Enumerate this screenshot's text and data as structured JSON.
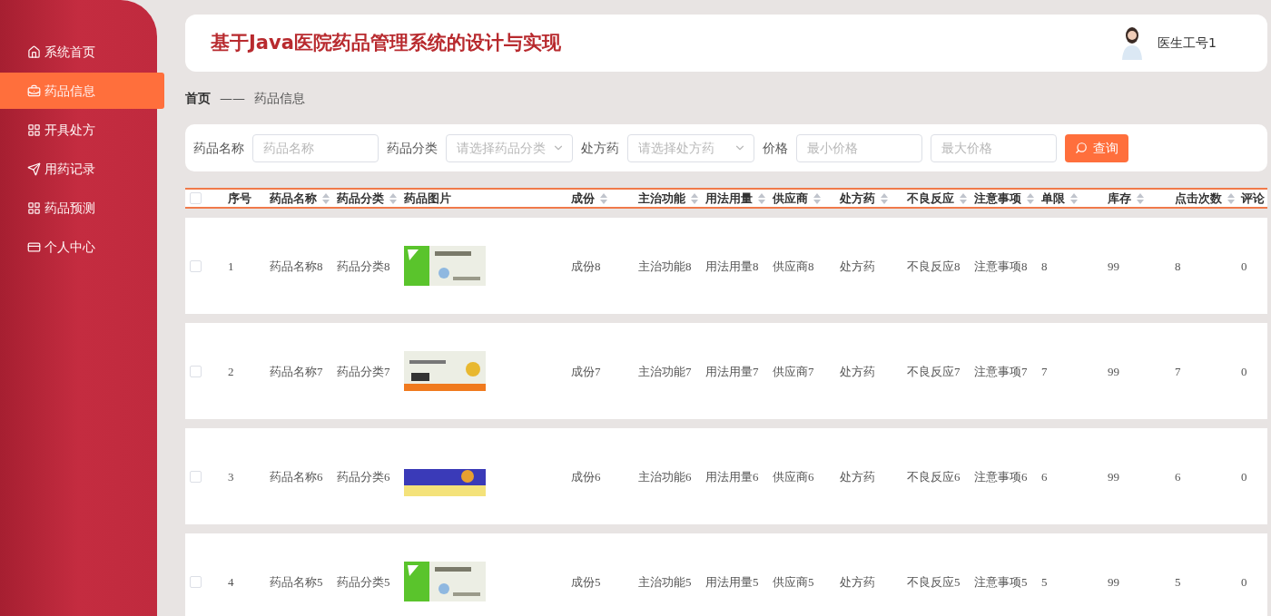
{
  "sidebar": {
    "items": [
      {
        "label": "系统首页",
        "selected": false
      },
      {
        "label": "药品信息",
        "selected": true
      },
      {
        "label": "开具处方",
        "selected": false
      },
      {
        "label": "用药记录",
        "selected": false
      },
      {
        "label": "药品预测",
        "selected": false
      },
      {
        "label": "个人中心",
        "selected": false
      }
    ]
  },
  "header": {
    "title": "基于Java医院药品管理系统的设计与实现",
    "user": "医生工号1"
  },
  "breadcrumb": [
    "首页",
    "——",
    "药品信息"
  ],
  "search": {
    "fields": [
      {
        "label": "药品名称",
        "kind": "input",
        "placeholder": "药品名称"
      },
      {
        "label": "药品分类",
        "kind": "select",
        "placeholder": "请选择药品分类"
      },
      {
        "label": "处方药",
        "kind": "select",
        "placeholder": "请选择处方药"
      },
      {
        "label": "价格",
        "kind": "input",
        "placeholder": "最小价格"
      },
      {
        "kind": "input",
        "placeholder": "最大价格"
      }
    ],
    "button": "查询"
  },
  "table": {
    "all_checked": false,
    "columns": [
      {
        "label": "序号",
        "sortable": false
      },
      {
        "label": "药品名称",
        "sortable": true
      },
      {
        "label": "药品分类",
        "sortable": true
      },
      {
        "label": "药品图片",
        "sortable": false
      },
      {
        "label": "成份",
        "sortable": true
      },
      {
        "label": "主治功能",
        "sortable": true
      },
      {
        "label": "用法用量",
        "sortable": true
      },
      {
        "label": "供应商",
        "sortable": true
      },
      {
        "label": "处方药",
        "sortable": true
      },
      {
        "label": "不良反应",
        "sortable": true
      },
      {
        "label": "注意事项",
        "sortable": true
      },
      {
        "label": "单限",
        "sortable": true
      },
      {
        "label": "库存",
        "sortable": true
      },
      {
        "label": "点击次数",
        "sortable": true
      },
      {
        "label": "评论"
      }
    ],
    "rows": [
      {
        "checked": false,
        "cells": [
          "1",
          "药品名称8",
          "药品分类8",
          {
            "kind": "picture"
          },
          "成份8",
          "主治功能8",
          "用法用量8",
          "供应商8",
          "处方药",
          "不良反应8",
          "注意事项8",
          "8",
          "99",
          "8",
          "0"
        ]
      },
      {
        "checked": false,
        "cells": [
          "2",
          "药品名称7",
          "药品分类7",
          {
            "kind": "picture"
          },
          "成份7",
          "主治功能7",
          "用法用量7",
          "供应商7",
          "处方药",
          "不良反应7",
          "注意事项7",
          "7",
          "99",
          "7",
          "0"
        ]
      },
      {
        "checked": false,
        "cells": [
          "3",
          "药品名称6",
          "药品分类6",
          {
            "kind": "picture"
          },
          "成份6",
          "主治功能6",
          "用法用量6",
          "供应商6",
          "处方药",
          "不良反应6",
          "注意事项6",
          "6",
          "99",
          "6",
          "0"
        ]
      },
      {
        "checked": false,
        "cells": [
          "4",
          "药品名称5",
          "药品分类5",
          {
            "kind": "picture"
          },
          "成份5",
          "主治功能5",
          "用法用量5",
          "供应商5",
          "处方药",
          "不良反应5",
          "注意事项5",
          "5",
          "99",
          "5",
          "0"
        ]
      }
    ]
  }
}
